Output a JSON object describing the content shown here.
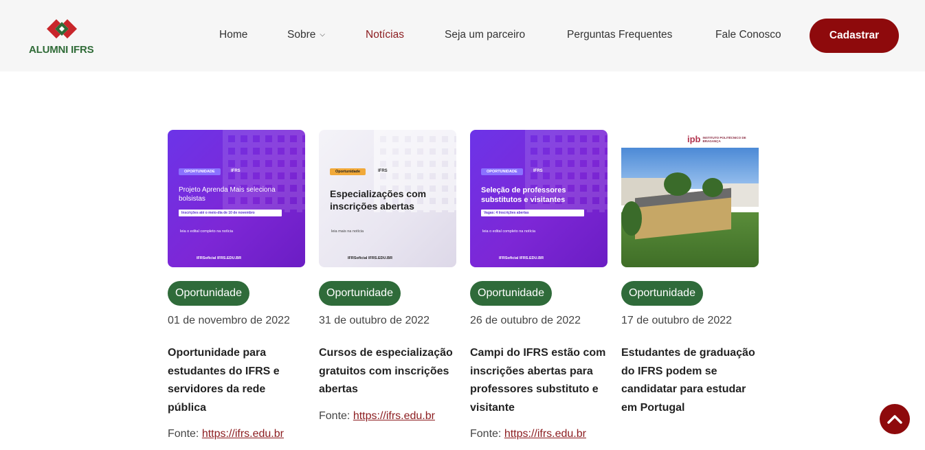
{
  "brand": {
    "name": "ALUMNI IFRS"
  },
  "nav": {
    "items": [
      {
        "label": "Home"
      },
      {
        "label": "Sobre"
      },
      {
        "label": "Notícias"
      },
      {
        "label": "Seja um parceiro"
      },
      {
        "label": "Perguntas Frequentes"
      },
      {
        "label": "Fale Conosco"
      }
    ],
    "active": "Notícias",
    "cta_label": "Cadastrar"
  },
  "colors": {
    "accent": "#8e0a0c",
    "tag": "#2f6b3a",
    "link": "#8b1b1e"
  },
  "cards": [
    {
      "thumb": {
        "tag": "OPORTUNIDADE",
        "org": "IFRS",
        "title": "Projeto Aprenda Mais seleciona bolsistas",
        "bar": "Inscrições até o meio-dia de 10 de novembro",
        "note": "leia o edital completo na notícia",
        "footer": "IFRSoficial   IFRS.EDU.BR"
      },
      "tag": "Oportunidade",
      "date": "01 de novembro de 2022",
      "title": "Oportunidade para estudantes do IFRS e servidores da rede pública",
      "source_label": "Fonte:",
      "source_link": "https://ifrs.edu.br"
    },
    {
      "thumb": {
        "tag": "Oportunidade",
        "org": "IFRS",
        "title": "Especializações com inscrições abertas",
        "note": "leia mais na notícia",
        "footer": "IFRSoficial   IFRS.EDU.BR"
      },
      "tag": "Oportunidade",
      "date": "31 de outubro de 2022",
      "title": "Cursos de especialização gratuitos com inscrições abertas",
      "source_label": "Fonte:",
      "source_link": "https://ifrs.edu.br"
    },
    {
      "thumb": {
        "tag": "OPORTUNIDADE",
        "org": "IFRS",
        "title": "Seleção de professores substitutos e visitantes",
        "bar": "Vagas: 4           Inscrições abertas",
        "note": "leia o edital completo na notícia",
        "footer": "IFRSoficial   IFRS.EDU.BR"
      },
      "tag": "Oportunidade",
      "date": "26 de outubro de 2022",
      "title": "Campi do IFRS estão com inscrições abertas para professores substituto e visitante",
      "source_label": "Fonte:",
      "source_link": "https://ifrs.edu.br"
    },
    {
      "thumb": {
        "logo": "ipb",
        "logo_sub": "INSTITUTO POLITÉCNICO DE BRAGANÇA"
      },
      "tag": "Oportunidade",
      "date": "17 de outubro de 2022",
      "title": "Estudantes de graduação do IFRS podem se candidatar para estudar em Portugal"
    }
  ],
  "icons": {
    "logo": "alumni-logo-icon",
    "dropdown": "chevron-down-icon",
    "scroll_top": "chevron-up-icon"
  }
}
